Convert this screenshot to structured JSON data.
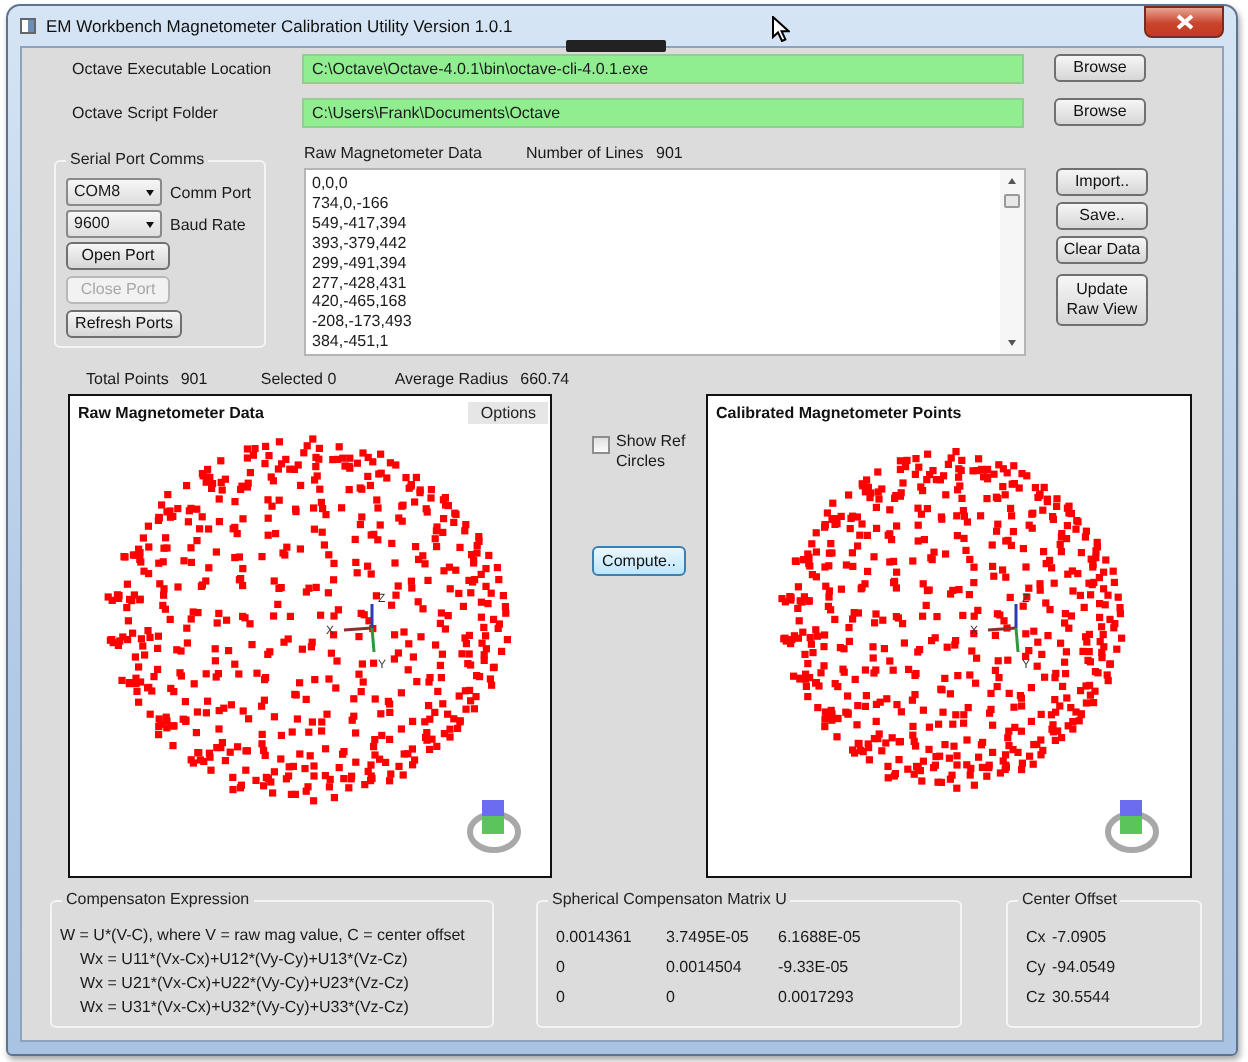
{
  "window": {
    "title": "EM Workbench Magnetometer Calibration Utility Version 1.0.1"
  },
  "paths": [
    {
      "label": "Octave Executable Location",
      "value": "C:\\Octave\\Octave-4.0.1\\bin\\octave-cli-4.0.1.exe",
      "valid": true,
      "button": "Browse"
    },
    {
      "label": "Octave Script Folder",
      "value": "C:\\Users\\Frank\\Documents\\Octave",
      "valid": true,
      "button": "Browse"
    }
  ],
  "serial": {
    "title": "Serial Port Comms",
    "selectors": [
      {
        "value": "COM8",
        "label": "Comm Port"
      },
      {
        "value": "9600",
        "label": "Baud Rate"
      }
    ],
    "buttons": [
      {
        "label": "Open Port",
        "disabled": false
      },
      {
        "label": "Close Port",
        "disabled": true
      },
      {
        "label": "Refresh Ports",
        "disabled": false
      }
    ]
  },
  "raw_data": {
    "label": "Raw Magnetometer Data",
    "count_label": "Number of Lines",
    "count": "901",
    "lines": [
      "0,0,0",
      "734,0,-166",
      "549,-417,394",
      "393,-379,442",
      "299,-491,394",
      "277,-428,431",
      "420,-465,168",
      "-208,-173,493",
      "384,-451,1"
    ]
  },
  "actions": [
    "Import..",
    "Save..",
    "Clear Data",
    "Update Raw View"
  ],
  "stats": [
    {
      "label": "Total Points",
      "value": "901"
    },
    {
      "label": "Selected 0"
    },
    {
      "label": "Average Radius",
      "value": "660.74"
    }
  ],
  "plots": [
    {
      "title": "Raw Magnetometer Data",
      "options": "Options",
      "axis_labels": [
        "X",
        "Y",
        "Z"
      ]
    },
    {
      "title": "Calibrated Magnetometer Points",
      "axis_labels": [
        "X",
        "Y",
        "Z"
      ]
    }
  ],
  "show_ref_circles": {
    "label": "Show Ref Circles",
    "checked": false
  },
  "compute": "Compute..",
  "expression": {
    "title": "Compensaton Expression",
    "lines": [
      "W = U*(V-C), where V = raw mag value, C = center offset",
      "Wx = U11*(Vx-Cx)+U12*(Vy-Cy)+U13*(Vz-Cz)",
      "Wx = U21*(Vx-Cx)+U22*(Vy-Cy)+U23*(Vz-Cz)",
      "Wx = U31*(Vx-Cx)+U32*(Vy-Cy)+U33*(Vz-Cz)"
    ]
  },
  "matrix": {
    "title": "Spherical Compensaton Matrix U",
    "rows": [
      [
        "0.0014361",
        "3.7495E-05",
        "6.1688E-05"
      ],
      [
        "0",
        "0.0014504",
        "-9.33E-05"
      ],
      [
        "0",
        "0",
        "0.0017293"
      ]
    ]
  },
  "center": {
    "title": "Center Offset",
    "rows": [
      {
        "label": "Cx",
        "value": "-7.0905"
      },
      {
        "label": "Cy",
        "value": "-94.0549"
      },
      {
        "label": "Cz",
        "value": "30.5544"
      }
    ]
  }
}
